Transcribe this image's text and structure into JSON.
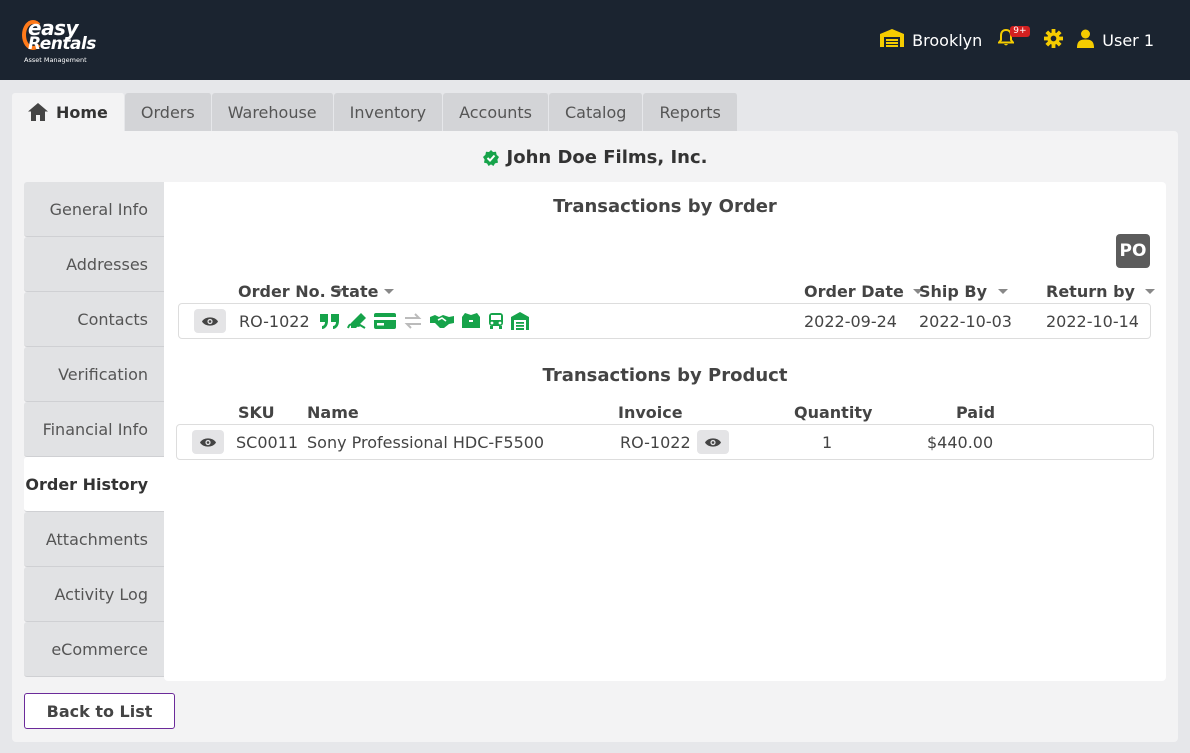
{
  "app": {
    "logo_top": "easy",
    "logo_bottom": "Rentals",
    "logo_subtitle": "Asset Management",
    "location": "Brooklyn",
    "notification_badge": "9+",
    "user_name": "User 1",
    "colors": {
      "topbar": "#1b2430",
      "accent": "#f5cc00",
      "success": "#16a34a",
      "badge": "#d32020"
    }
  },
  "tabs": [
    {
      "label": "Home",
      "icon": "home-icon",
      "active": true
    },
    {
      "label": "Orders"
    },
    {
      "label": "Warehouse"
    },
    {
      "label": "Inventory"
    },
    {
      "label": "Accounts"
    },
    {
      "label": "Catalog"
    },
    {
      "label": "Reports"
    }
  ],
  "customer": {
    "name": "John Doe Films, Inc.",
    "verified_icon": "verified-check-icon"
  },
  "sidenav": [
    {
      "label": "General Info"
    },
    {
      "label": "Addresses"
    },
    {
      "label": "Contacts"
    },
    {
      "label": "Verification"
    },
    {
      "label": "Financial Info"
    },
    {
      "label": "Order History",
      "active": true
    },
    {
      "label": "Attachments"
    },
    {
      "label": "Activity Log"
    },
    {
      "label": "eCommerce"
    }
  ],
  "orders": {
    "title": "Transactions by Order",
    "po_label": "PO",
    "columns": {
      "order_no": "Order No.",
      "state": "State",
      "order_date": "Order Date",
      "ship_by": "Ship By",
      "return_by": "Return by"
    },
    "rows": [
      {
        "order_no": "RO-1022",
        "order_date": "2022-09-24",
        "ship_by": "2022-10-03",
        "return_by": "2022-10-14",
        "state_icons": [
          "quote-icon",
          "signature-icon",
          "credit-card-icon",
          "exchange-icon",
          "handshake-icon",
          "box-open-icon",
          "truck-icon",
          "warehouse-icon"
        ]
      }
    ]
  },
  "products": {
    "title": "Transactions by Product",
    "columns": {
      "sku": "SKU",
      "name": "Name",
      "invoice": "Invoice",
      "quantity": "Quantity",
      "paid": "Paid"
    },
    "rows": [
      {
        "sku": "SC0011",
        "name": "Sony Professional HDC-F5500",
        "invoice": "RO-1022",
        "quantity": "1",
        "paid": "$440.00"
      }
    ]
  },
  "footer": {
    "back_label": "Back to List"
  }
}
